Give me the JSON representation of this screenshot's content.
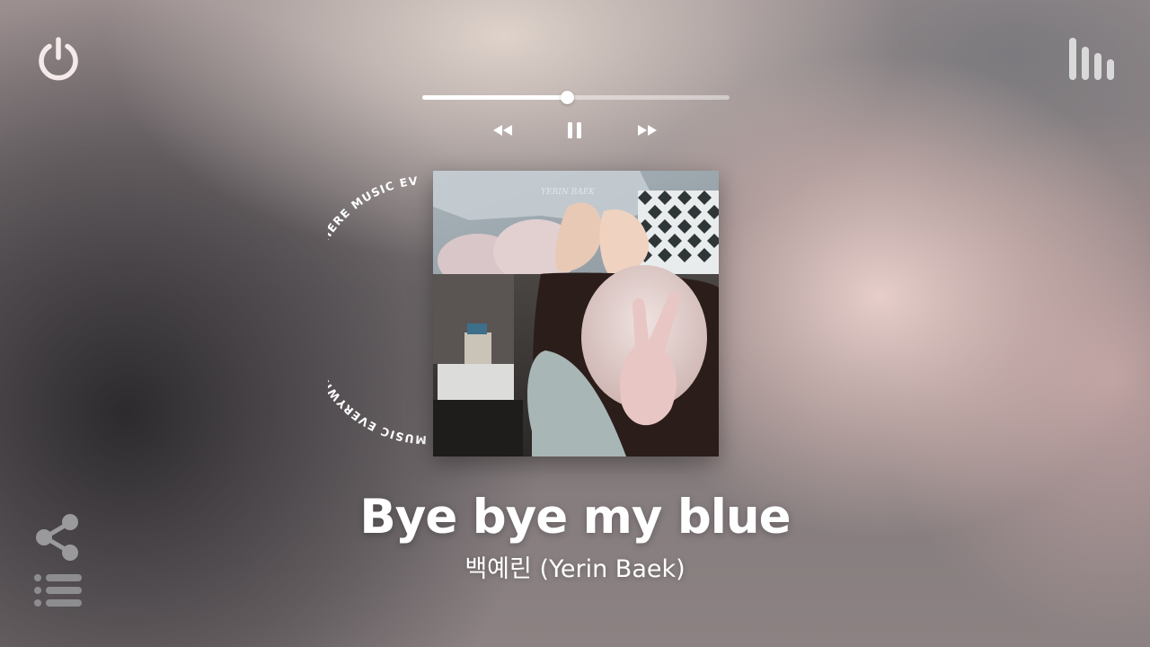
{
  "player": {
    "progress_fraction": 0.47,
    "ring_text": "MUSIC EVERYWHERE MUSIC EVERYWHERE MUSIC EV"
  },
  "track": {
    "title": "Bye bye my blue",
    "artist": "백예린 (Yerin Baek)"
  },
  "album_art": {
    "cover_text": "YERIN BAEK"
  },
  "icons": {
    "power": "power-icon",
    "bars": "equalizer-bars-icon",
    "prev": "rewind-icon",
    "pause": "pause-icon",
    "next": "fast-forward-icon",
    "share": "share-icon",
    "list": "playlist-icon"
  },
  "colors": {
    "icon_light": "#f3e6e6",
    "white": "#ffffff"
  }
}
